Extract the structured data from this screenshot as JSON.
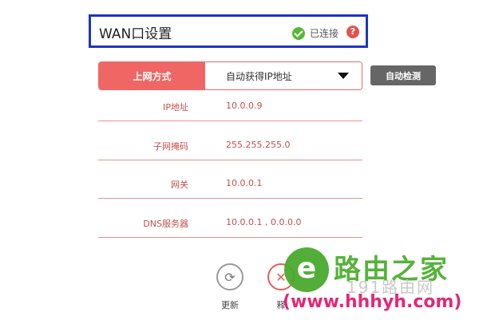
{
  "header": {
    "title": "WAN口设置",
    "status": "已连接",
    "help": "?"
  },
  "connection": {
    "label": "上网方式",
    "selected": "自动获得IP地址",
    "detect_label": "自动检测"
  },
  "info": [
    {
      "label": "IP地址",
      "value": "10.0.0.9"
    },
    {
      "label": "子网掩码",
      "value": "255.255.255.0"
    },
    {
      "label": "网关",
      "value": "10.0.0.1"
    },
    {
      "label": "DNS服务器",
      "value": "10.0.0.1 , 0.0.0.0"
    }
  ],
  "actions": {
    "refresh_label": "更新",
    "release_label": "释"
  },
  "watermark": {
    "logo_letter": "e",
    "brand": "路由之家",
    "faint": "191路由网",
    "url": "(www.hhhyh.com)"
  },
  "colors": {
    "accent": "#ef6664",
    "header_border": "#1a36c4",
    "connected": "#57b836",
    "detect_button": "#666666"
  }
}
